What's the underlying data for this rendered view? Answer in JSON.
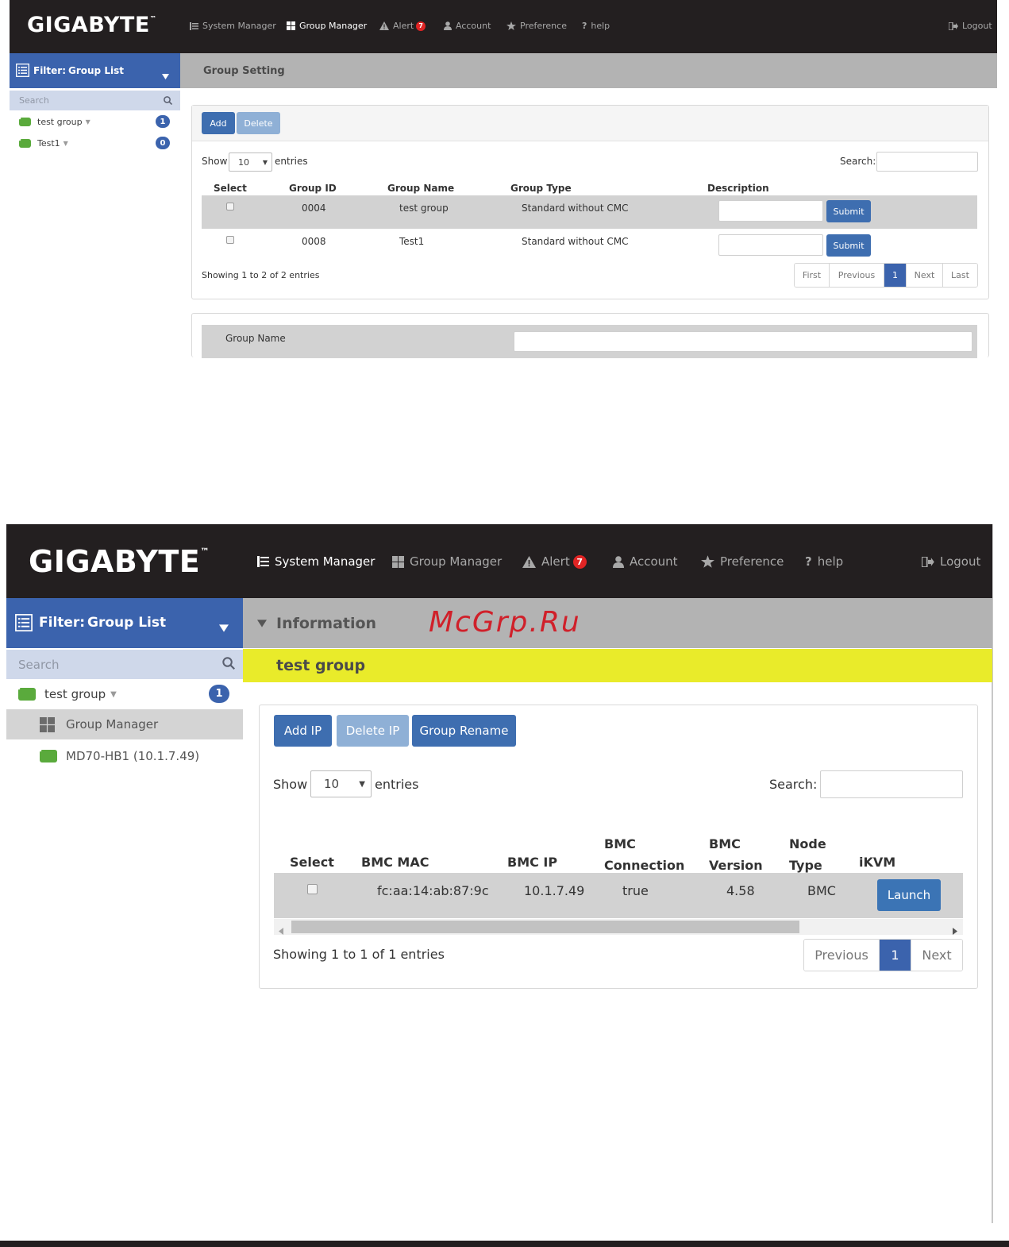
{
  "screen1": {
    "logo": "GIGABYTE",
    "logo_tm": "™",
    "nav": [
      {
        "label": "System Manager",
        "icon": "list-icon"
      },
      {
        "label": "Group Manager",
        "icon": "grid-icon"
      },
      {
        "label": "Alert",
        "icon": "warning-icon",
        "badge": "7"
      },
      {
        "label": "Account",
        "icon": "user-icon"
      },
      {
        "label": "Preference",
        "icon": "star-icon"
      },
      {
        "label": "help",
        "icon": "question-icon"
      }
    ],
    "logout": "Logout",
    "filter_label": "Filter:",
    "filter_value": "Group List",
    "search_placeholder": "Search",
    "tree": [
      {
        "label": "test group",
        "count": "1"
      },
      {
        "label": "Test1",
        "count": "0"
      }
    ],
    "section_title": "Group Setting",
    "add_button": "Add",
    "delete_button": "Delete",
    "show_label": "Show",
    "entries_label": "entries",
    "entries_value": "10",
    "search_label": "Search:",
    "columns": [
      "Select",
      "Group ID",
      "Group Name",
      "Group Type",
      "Description"
    ],
    "rows": [
      {
        "id": "0004",
        "name": "test group",
        "type": "Standard without CMC",
        "submit": "Submit"
      },
      {
        "id": "0008",
        "name": "Test1",
        "type": "Standard without CMC",
        "submit": "Submit"
      }
    ],
    "showing": "Showing 1 to 2 of 2 entries",
    "pager": [
      "First",
      "Previous",
      "1",
      "Next",
      "Last"
    ],
    "group_name_label": "Group Name"
  },
  "screen2": {
    "logo": "GIGABYTE",
    "logo_tm": "™",
    "nav": [
      {
        "label": "System Manager",
        "icon": "list-icon"
      },
      {
        "label": "Group Manager",
        "icon": "grid-icon"
      },
      {
        "label": "Alert",
        "icon": "warning-icon",
        "badge": "7"
      },
      {
        "label": "Account",
        "icon": "user-icon"
      },
      {
        "label": "Preference",
        "icon": "star-icon"
      },
      {
        "label": "help",
        "icon": "question-icon"
      }
    ],
    "logout": "Logout",
    "filter_label": "Filter:",
    "filter_value": "Group List",
    "info_title": "Information",
    "watermark": "McGrp.Ru",
    "search_placeholder": "Search",
    "tree_group": {
      "label": "test group",
      "count": "1"
    },
    "tree_manager": "Group Manager",
    "tree_node": "MD70-HB1 (10.1.7.49)",
    "group_title": "test group",
    "buttons": {
      "add_ip": "Add IP",
      "delete_ip": "Delete IP",
      "rename": "Group Rename"
    },
    "show_label": "Show",
    "entries_label": "entries",
    "entries_value": "10",
    "search_label": "Search:",
    "columns": {
      "select": "Select",
      "mac": "BMC MAC",
      "ip": "BMC IP",
      "conn_1": "BMC",
      "conn_2": "Connection",
      "ver_1": "BMC",
      "ver_2": "Version",
      "node_1": "Node",
      "node_2": "Type",
      "ikvm": "iKVM"
    },
    "row": {
      "mac": "fc:aa:14:ab:87:9c",
      "ip": "10.1.7.49",
      "connection": "true",
      "version": "4.58",
      "node_type": "BMC",
      "launch": "Launch"
    },
    "showing": "Showing 1 to 1 of 1 entries",
    "pager": [
      "Previous",
      "1",
      "Next"
    ]
  }
}
